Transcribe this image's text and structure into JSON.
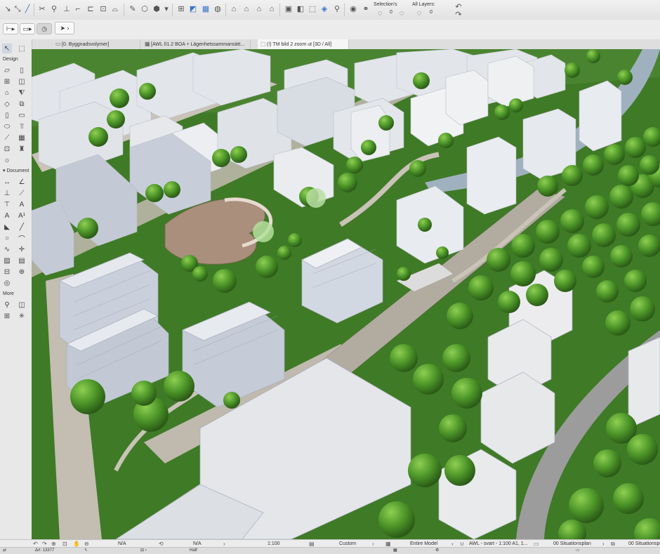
{
  "toolbar": {
    "selection_label": "Selection's",
    "selection_value": "0",
    "layers_label": "All Layers:",
    "layers_value": "0"
  },
  "tabs": [
    {
      "label": "[0. Byggnadsvolymer]"
    },
    {
      "label": "[AWL 01.2 BOA + Lägenhetssammansätt..."
    },
    {
      "label": "(!) TM bild 2 zoom ut  [3D / All]"
    }
  ],
  "toolbox": {
    "design_label": "Design",
    "document_label": "Document",
    "more_label": "More"
  },
  "status": {
    "field1": "N/A",
    "field2": "N/A",
    "scale": "1:100",
    "custom": "Custom",
    "model": "Entire Model",
    "pen_set": "AWL - svart - 1:100 A1, 1...",
    "view1": "00 Situationsplan",
    "view2": "00 Situationspl"
  },
  "info": {
    "id": "13377",
    "half": "Half"
  },
  "colors": {
    "grass": "#3f7a26",
    "road": "#c7c1b6",
    "building": "#e4e7ec",
    "water": "#9eb0be",
    "tree": "#4f9a2e"
  }
}
